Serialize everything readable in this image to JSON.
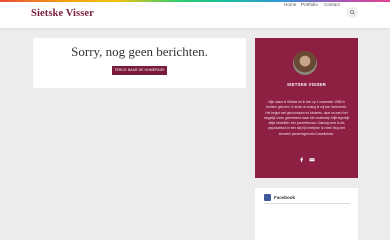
{
  "brand": {
    "logo_text": "Sietske Visser",
    "accent_color": "#7a1b3a"
  },
  "nav": {
    "items": [
      {
        "label": "Home"
      },
      {
        "label": "Portfolio"
      },
      {
        "label": "Contact"
      }
    ],
    "search_icon": "search-icon"
  },
  "main": {
    "title": "Sorry, nog geen berichten.",
    "button_label": "TERUG NAAR DE HOMEPAGE"
  },
  "profile": {
    "name": "SIETSKE VISSER",
    "bio": "Mijn naam is Sietske en ik ben op 1 november 1985 in Arnhem geboren. Ik lezen al zolang ik mij kan herinneren. Het begint met gehoorzaam en luisteren, daar na werd het mogelijk zomo gemeteend maar het onderwerp blijft eigenlijk altijd hetzelfde: een juweeltevraat. Daarlag werk ik als psychiatrisch in een stijl rijk leerlijnen ik vrienl hing met leerwerk psewerkgeld als Erasbibrioeo.",
    "card_color": "#8c1f42",
    "social_icons": [
      "facebook-icon",
      "mail-icon"
    ]
  },
  "facebook_widget": {
    "title": "Facebook",
    "icon": "facebook-icon"
  }
}
